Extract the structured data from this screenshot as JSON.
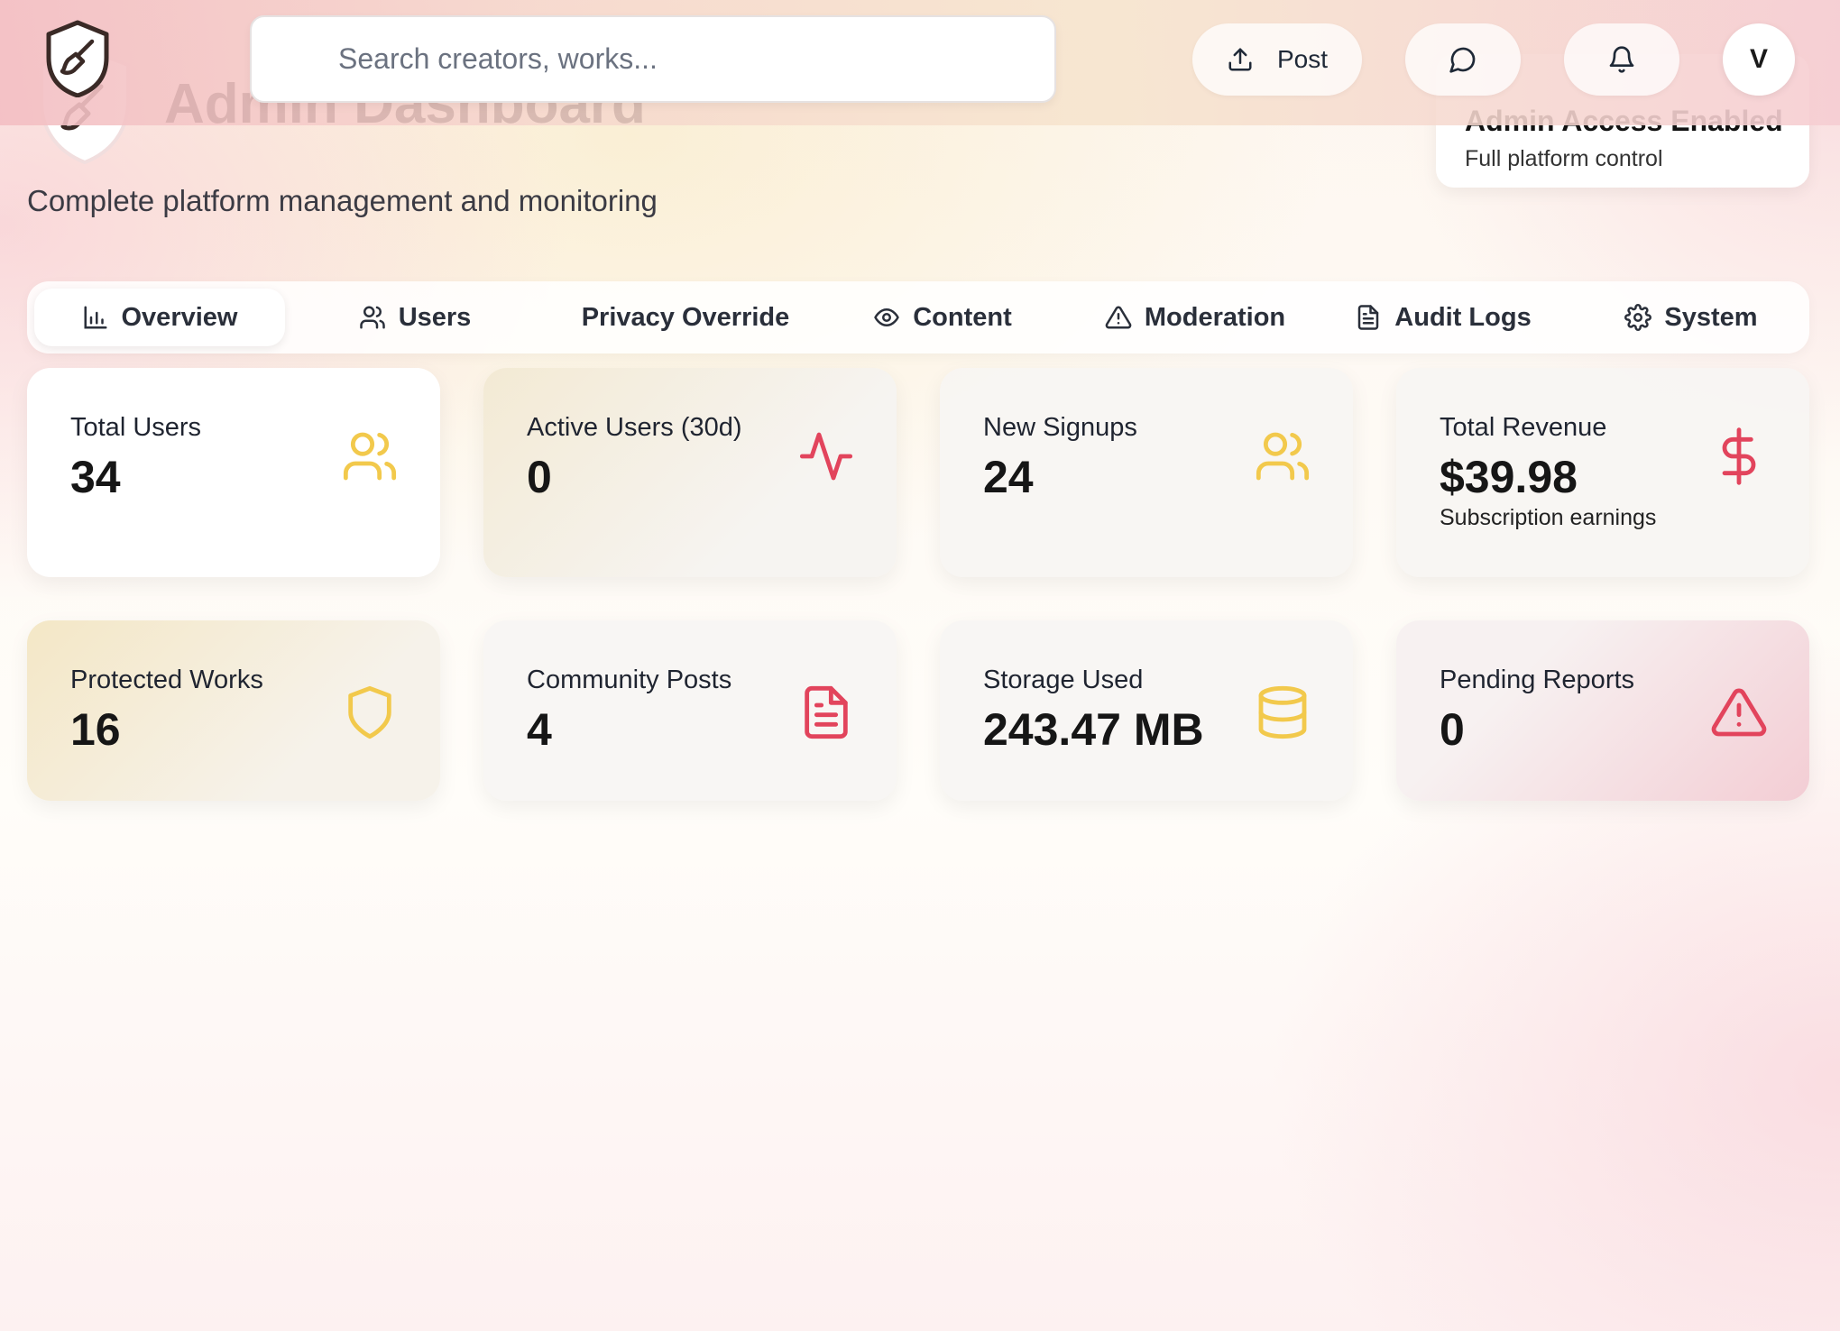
{
  "header": {
    "search_placeholder": "Search creators, works...",
    "post_label": "Post",
    "avatar_initial": "V",
    "page_title": "Admin Dashboard",
    "subtitle": "Complete platform management and monitoring",
    "access_title": "Admin Access Enabled",
    "access_subtitle": "Full platform control"
  },
  "tabs": [
    {
      "label": "Overview",
      "icon": "bar-chart-icon",
      "active": true
    },
    {
      "label": "Users",
      "icon": "users-icon"
    },
    {
      "label": "Privacy Override",
      "icon": ""
    },
    {
      "label": "Content",
      "icon": "eye-icon"
    },
    {
      "label": "Moderation",
      "icon": "warning-icon"
    },
    {
      "label": "Audit Logs",
      "icon": "document-icon"
    },
    {
      "label": "System",
      "icon": "gear-icon"
    }
  ],
  "stats": [
    {
      "label": "Total Users",
      "value": "34",
      "icon": "users-icon",
      "color": "#f2c94c"
    },
    {
      "label": "Active Users (30d)",
      "value": "0",
      "icon": "activity-icon",
      "color": "#e2445c"
    },
    {
      "label": "New Signups",
      "value": "24",
      "icon": "users-icon",
      "color": "#f2c94c"
    },
    {
      "label": "Total Revenue",
      "value": "$39.98",
      "note": "Subscription earnings",
      "icon": "dollar-icon",
      "color": "#e2445c"
    },
    {
      "label": "Protected Works",
      "value": "16",
      "icon": "shield-icon",
      "color": "#f2c94c"
    },
    {
      "label": "Community Posts",
      "value": "4",
      "icon": "document-icon",
      "color": "#e2445c"
    },
    {
      "label": "Storage Used",
      "value": "243.47 MB",
      "icon": "database-icon",
      "color": "#f2c94c"
    },
    {
      "label": "Pending Reports",
      "value": "0",
      "icon": "warning-icon",
      "color": "#e2445c"
    }
  ],
  "colors": {
    "accent_gold": "#f2c94c",
    "accent_red": "#e2445c"
  }
}
